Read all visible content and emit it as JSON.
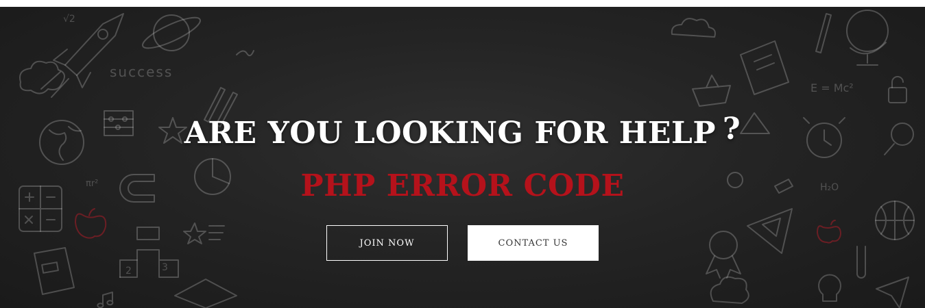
{
  "hero": {
    "headline": "ARE YOU LOOKING FOR HELP",
    "question_mark": "?",
    "subheadline": "PHP ERROR CODE",
    "buttons": {
      "join_label": "JOIN NOW",
      "contact_label": "CONTACT US"
    },
    "colors": {
      "background": "#242424",
      "accent": "#b5121b",
      "headline": "#ffffff"
    },
    "doodle_text": {
      "success": "success",
      "formula": "E = Mc²",
      "sqrt": "√2",
      "water": "H₂O",
      "pi_r": "πr²"
    }
  }
}
